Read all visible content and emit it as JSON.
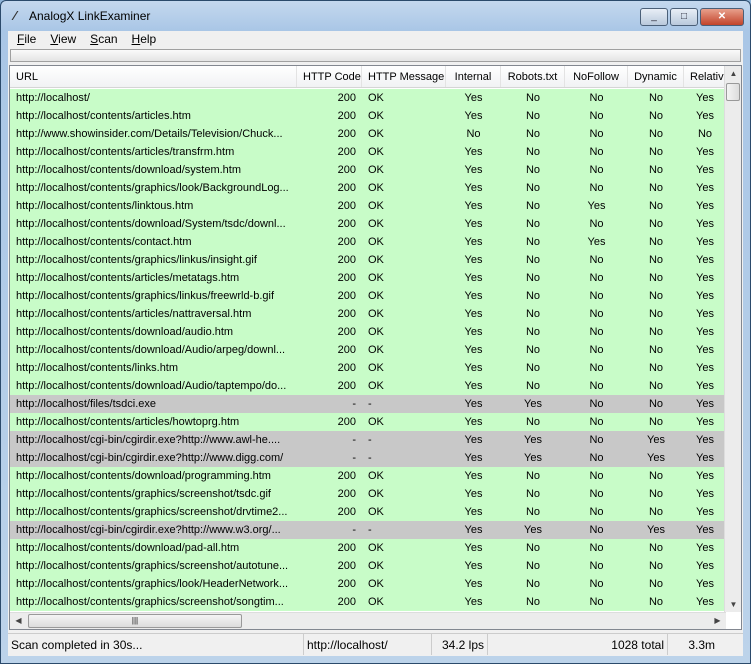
{
  "window": {
    "title": "AnalogX LinkExaminer",
    "minimize": "_",
    "maximize": "□",
    "close": "✕"
  },
  "menu": [
    {
      "label": "File",
      "key": "F",
      "rest": "ile"
    },
    {
      "label": "View",
      "key": "V",
      "rest": "iew"
    },
    {
      "label": "Scan",
      "key": "S",
      "rest": "can"
    },
    {
      "label": "Help",
      "key": "H",
      "rest": "elp"
    }
  ],
  "columns": [
    "URL",
    "HTTP Code",
    "HTTP Message",
    "Internal",
    "Robots.txt",
    "NoFollow",
    "Dynamic",
    "Relative"
  ],
  "rows": [
    [
      "http://localhost/",
      "200",
      "OK",
      "Yes",
      "No",
      "No",
      "No",
      "Yes"
    ],
    [
      "http://localhost/contents/articles.htm",
      "200",
      "OK",
      "Yes",
      "No",
      "No",
      "No",
      "Yes"
    ],
    [
      "http://www.showinsider.com/Details/Television/Chuck...",
      "200",
      "OK",
      "No",
      "No",
      "No",
      "No",
      "No"
    ],
    [
      "http://localhost/contents/articles/transfrm.htm",
      "200",
      "OK",
      "Yes",
      "No",
      "No",
      "No",
      "Yes"
    ],
    [
      "http://localhost/contents/download/system.htm",
      "200",
      "OK",
      "Yes",
      "No",
      "No",
      "No",
      "Yes"
    ],
    [
      "http://localhost/contents/graphics/look/BackgroundLog...",
      "200",
      "OK",
      "Yes",
      "No",
      "No",
      "No",
      "Yes"
    ],
    [
      "http://localhost/contents/linktous.htm",
      "200",
      "OK",
      "Yes",
      "No",
      "Yes",
      "No",
      "Yes"
    ],
    [
      "http://localhost/contents/download/System/tsdc/downl...",
      "200",
      "OK",
      "Yes",
      "No",
      "No",
      "No",
      "Yes"
    ],
    [
      "http://localhost/contents/contact.htm",
      "200",
      "OK",
      "Yes",
      "No",
      "Yes",
      "No",
      "Yes"
    ],
    [
      "http://localhost/contents/graphics/linkus/insight.gif",
      "200",
      "OK",
      "Yes",
      "No",
      "No",
      "No",
      "Yes"
    ],
    [
      "http://localhost/contents/articles/metatags.htm",
      "200",
      "OK",
      "Yes",
      "No",
      "No",
      "No",
      "Yes"
    ],
    [
      "http://localhost/contents/graphics/linkus/freewrld-b.gif",
      "200",
      "OK",
      "Yes",
      "No",
      "No",
      "No",
      "Yes"
    ],
    [
      "http://localhost/contents/articles/nattraversal.htm",
      "200",
      "OK",
      "Yes",
      "No",
      "No",
      "No",
      "Yes"
    ],
    [
      "http://localhost/contents/download/audio.htm",
      "200",
      "OK",
      "Yes",
      "No",
      "No",
      "No",
      "Yes"
    ],
    [
      "http://localhost/contents/download/Audio/arpeg/downl...",
      "200",
      "OK",
      "Yes",
      "No",
      "No",
      "No",
      "Yes"
    ],
    [
      "http://localhost/contents/links.htm",
      "200",
      "OK",
      "Yes",
      "No",
      "No",
      "No",
      "Yes"
    ],
    [
      "http://localhost/contents/download/Audio/taptempo/do...",
      "200",
      "OK",
      "Yes",
      "No",
      "No",
      "No",
      "Yes"
    ],
    [
      "http://localhost/files/tsdci.exe",
      "-",
      "-",
      "Yes",
      "Yes",
      "No",
      "No",
      "Yes"
    ],
    [
      "http://localhost/contents/articles/howtoprg.htm",
      "200",
      "OK",
      "Yes",
      "No",
      "No",
      "No",
      "Yes"
    ],
    [
      "http://localhost/cgi-bin/cgirdir.exe?http://www.awl-he....",
      "-",
      "-",
      "Yes",
      "Yes",
      "No",
      "Yes",
      "Yes"
    ],
    [
      "http://localhost/cgi-bin/cgirdir.exe?http://www.digg.com/",
      "-",
      "-",
      "Yes",
      "Yes",
      "No",
      "Yes",
      "Yes"
    ],
    [
      "http://localhost/contents/download/programming.htm",
      "200",
      "OK",
      "Yes",
      "No",
      "No",
      "No",
      "Yes"
    ],
    [
      "http://localhost/contents/graphics/screenshot/tsdc.gif",
      "200",
      "OK",
      "Yes",
      "No",
      "No",
      "No",
      "Yes"
    ],
    [
      "http://localhost/contents/graphics/screenshot/drvtime2...",
      "200",
      "OK",
      "Yes",
      "No",
      "No",
      "No",
      "Yes"
    ],
    [
      "http://localhost/cgi-bin/cgirdir.exe?http://www.w3.org/...",
      "-",
      "-",
      "Yes",
      "Yes",
      "No",
      "Yes",
      "Yes"
    ],
    [
      "http://localhost/contents/download/pad-all.htm",
      "200",
      "OK",
      "Yes",
      "No",
      "No",
      "No",
      "Yes"
    ],
    [
      "http://localhost/contents/graphics/screenshot/autotune...",
      "200",
      "OK",
      "Yes",
      "No",
      "No",
      "No",
      "Yes"
    ],
    [
      "http://localhost/contents/graphics/look/HeaderNetwork...",
      "200",
      "OK",
      "Yes",
      "No",
      "No",
      "No",
      "Yes"
    ],
    [
      "http://localhost/contents/graphics/screenshot/songtim...",
      "200",
      "OK",
      "Yes",
      "No",
      "No",
      "No",
      "Yes"
    ]
  ],
  "colors": {
    "ok_row": "#c8fcc8",
    "skipped_row": "#c8c8c8"
  },
  "status": {
    "message": "Scan completed in 30s...",
    "url": "http://localhost/",
    "rate": "34.2 lps",
    "total": "1028 total",
    "time": "3.3m"
  }
}
